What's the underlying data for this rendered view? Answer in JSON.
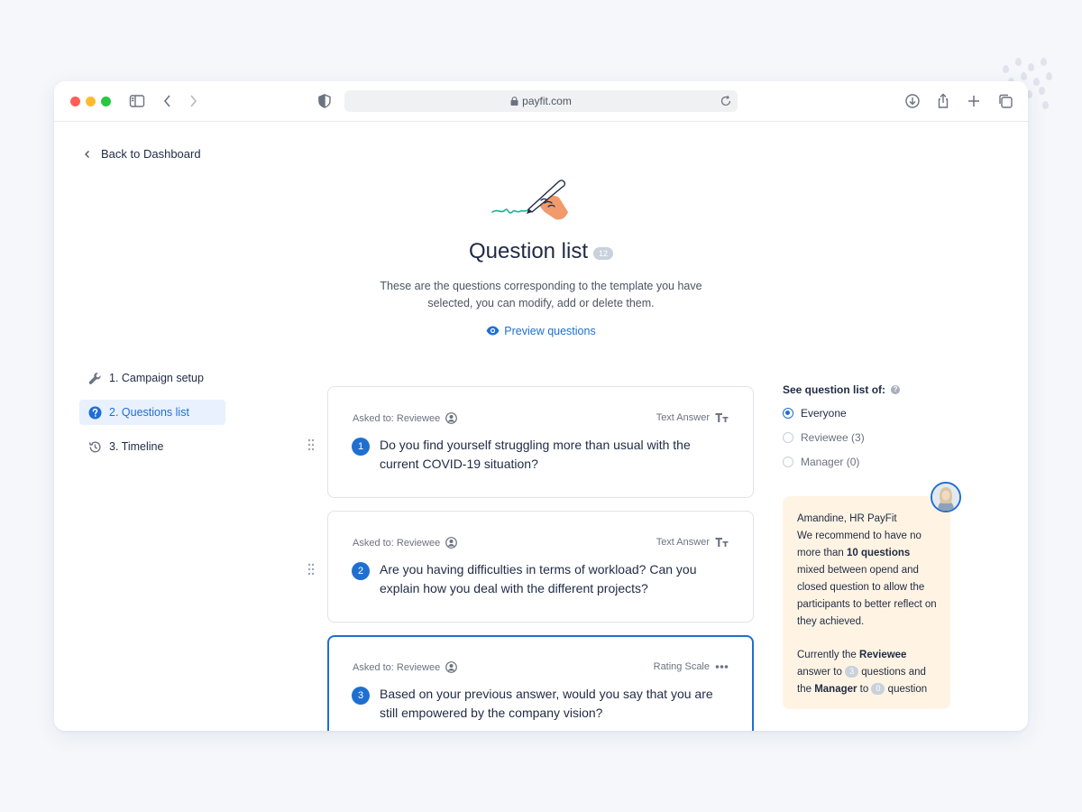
{
  "browser": {
    "url": "payfit.com"
  },
  "nav": {
    "back_label": "Back to Dashboard"
  },
  "header": {
    "title": "Question list",
    "count": "12",
    "subtitle": "These are the questions corresponding to the template you have selected, you can modify, add or delete them.",
    "preview_label": "Preview questions"
  },
  "steps": [
    {
      "label": "1. Campaign setup",
      "icon": "wrench-icon"
    },
    {
      "label": "2. Questions list",
      "icon": "question-circle-icon"
    },
    {
      "label": "3. Timeline",
      "icon": "history-icon"
    }
  ],
  "questions": [
    {
      "asked_to": "Asked to: Reviewee",
      "answer_type": "Text Answer",
      "number": "1",
      "text": "Do you find yourself struggling more than usual with the current COVID-19 situation?"
    },
    {
      "asked_to": "Asked to: Reviewee",
      "answer_type": "Text Answer",
      "number": "2",
      "text": "Are you having difficulties in terms of workload? Can you explain how you deal with the different projects?"
    },
    {
      "asked_to": "Asked to: Reviewee",
      "answer_type": "Rating Scale",
      "number": "3",
      "text": "Based on your previous answer, would you say that you are still empowered by the company vision?"
    }
  ],
  "filter": {
    "title": "See question list of:",
    "help": "?",
    "options": [
      "Everyone",
      "Reviewee (3)",
      "Manager (0)"
    ],
    "selected": "Everyone"
  },
  "tip": {
    "author": "Amandine, HR PayFit",
    "p1_a": "We recommend to have no more than ",
    "p1_bold": "10 questions",
    "p1_b": " mixed between opend and closed question to allow the participants to better reflect on they achieved.",
    "p2_a": "Currently the ",
    "p2_reviewee": "Reviewee",
    "p2_b": " answer to ",
    "p2_reviewee_count": "3",
    "p2_c": " questions and the ",
    "p2_manager": "Manager",
    "p2_d": " to ",
    "p2_manager_count": "0",
    "p2_e": " question"
  },
  "colors": {
    "accent": "#1f6fd1",
    "tip_bg": "#fff4e3",
    "text": "#1f2a44"
  }
}
